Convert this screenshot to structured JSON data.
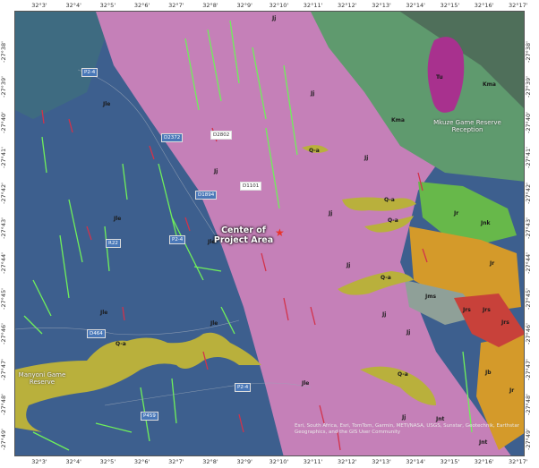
{
  "longitude_labels": [
    "32°3'",
    "32°4'",
    "32°5'",
    "32°6'",
    "32°7'",
    "32°8'",
    "32°9'",
    "32°10'",
    "32°11'",
    "32°12'",
    "32°13'",
    "32°14'",
    "32°15'",
    "32°16'",
    "32°17'"
  ],
  "latitude_labels": [
    "-27°38'",
    "-27°39'",
    "-27°40'",
    "-27°41'",
    "-27°42'",
    "-27°43'",
    "-27°44'",
    "-27°45'",
    "-27°46'",
    "-27°47'",
    "-27°48'",
    "-27°49'"
  ],
  "center": {
    "label": "Center of Project Area"
  },
  "places": {
    "mkuze": "Mkuze Game Reserve Reception",
    "manyoni": "Manyoni Game Reserve"
  },
  "geology_labels": {
    "jle": "Jle",
    "jj": "Jj",
    "qa": "Q-a",
    "kma": "Kma",
    "tu": "Tu",
    "jr": "Jr",
    "jnk": "Jnk",
    "jms": "Jms",
    "jnt": "Jnt",
    "jb": "Jb",
    "jrs": "Jrs"
  },
  "roads": {
    "p24": "P2-4",
    "d2372": "D2372",
    "d1894": "D1894",
    "r22": "R22",
    "d464": "D464",
    "p459": "P459",
    "d2802": "D2802",
    "d1101": "D1101"
  },
  "attribution": "Esri, South Africa, Esri, TomTom, Garmin, METI/NASA, USGS, Sunstar, Geotechnik, Earthstar Geographics, and the GIS User Community",
  "colors": {
    "jle": "#3d5f8e",
    "jj": "#c580b8",
    "qa": "#b9b03c",
    "kma": "#5f9a6e",
    "tu": "#a8318e",
    "jr": "#d49a2a",
    "jnk": "#67b84a",
    "faults_green": "#6ff05a",
    "faults_red": "#d2324a"
  }
}
